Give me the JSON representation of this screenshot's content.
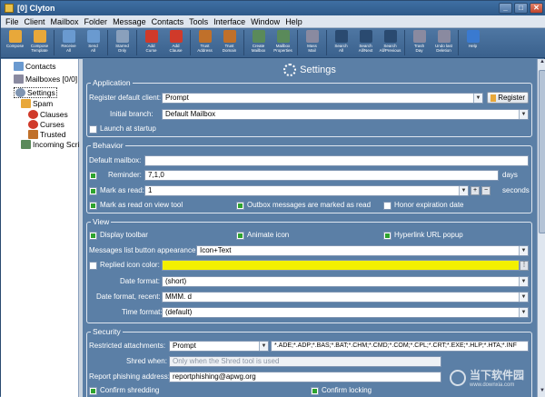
{
  "window": {
    "title": "[0] Clyton"
  },
  "menu": [
    "File",
    "Client",
    "Mailbox",
    "Folder",
    "Message",
    "Contacts",
    "Tools",
    "Interface",
    "Window",
    "Help"
  ],
  "toolbar": [
    {
      "label": "Compose",
      "icon": "compose-icon",
      "color": "#e8a83a"
    },
    {
      "label": "Compose\nTemplate",
      "icon": "template-icon",
      "color": "#e8a83a"
    },
    {
      "label": "Receive\nAll",
      "icon": "receive-icon",
      "color": "#6a9ad0"
    },
    {
      "label": "Send\nAll",
      "icon": "send-icon",
      "color": "#6a9ad0"
    },
    {
      "label": "Starred\nOnly",
      "icon": "star-icon",
      "color": "#8aa0bc"
    },
    {
      "label": "Add\nCurse",
      "icon": "curse-icon",
      "color": "#d03a2a"
    },
    {
      "label": "Add\nClause",
      "icon": "clause-icon",
      "color": "#d03a2a"
    },
    {
      "label": "Trust\nAddress",
      "icon": "trust-address-icon",
      "color": "#c0702a"
    },
    {
      "label": "Trust\nDomain",
      "icon": "trust-domain-icon",
      "color": "#c0702a"
    },
    {
      "label": "Create\nMailbox",
      "icon": "create-mailbox-icon",
      "color": "#5a8a5a"
    },
    {
      "label": "Mailbox\nProperties",
      "icon": "mailbox-properties-icon",
      "color": "#5a8a5a"
    },
    {
      "label": "Mass\nMail",
      "icon": "mass-mail-icon",
      "color": "#8a8aa0"
    },
    {
      "label": "Search\nAll",
      "icon": "search-all-icon",
      "color": "#2a4a70"
    },
    {
      "label": "Search\nAll/Next",
      "icon": "search-next-icon",
      "color": "#2a4a70"
    },
    {
      "label": "Search\nAll/Previous",
      "icon": "search-previous-icon",
      "color": "#2a4a70"
    },
    {
      "label": "Trash\nDay",
      "icon": "trash-icon",
      "color": "#8a8aa0"
    },
    {
      "label": "Undo last\nDeletion",
      "icon": "undo-icon",
      "color": "#8a8aa0"
    },
    {
      "label": "Help",
      "icon": "help-icon",
      "color": "#3a7ad0"
    }
  ],
  "tree": {
    "contacts": "Contacts",
    "mailboxes": "Mailboxes [0/0]",
    "settings": "Settings",
    "spam": "Spam",
    "clauses": "Clauses",
    "curses": "Curses",
    "trusted": "Trusted",
    "incoming": "Incoming Scripts"
  },
  "page": {
    "title": "Settings"
  },
  "application": {
    "legend": "Application",
    "register_label": "Register default client:",
    "register_value": "Prompt",
    "register_button": "Register",
    "branch_label": "Initial branch:",
    "branch_value": "Default Mailbox",
    "launch_label": "Launch at startup"
  },
  "behavior": {
    "legend": "Behavior",
    "default_mailbox_label": "Default mailbox:",
    "default_mailbox_value": "",
    "reminder_label": "Reminder:",
    "reminder_value": "7,1,0",
    "reminder_unit": "days",
    "mark_read_label": "Mark as read:",
    "mark_read_value": "1",
    "mark_read_unit": "seconds",
    "mark_view_label": "Mark as read on view tool",
    "outbox_label": "Outbox messages are marked as read",
    "honor_label": "Honor expiration date"
  },
  "view": {
    "legend": "View",
    "display_toolbar": "Display toolbar",
    "animate_icon": "Animate icon",
    "hyperlink_popup": "Hyperlink URL popup",
    "list_button_label": "Messages list button appearance:",
    "list_button_value": "Icon+Text",
    "replied_color_label": "Replied icon color:",
    "replied_color": "#f3f000",
    "date_format_label": "Date format:",
    "date_format_value": "(short)",
    "date_recent_label": "Date format, recent:",
    "date_recent_value": "MMM. d",
    "time_format_label": "Time format:",
    "time_format_value": "(default)"
  },
  "security": {
    "legend": "Security",
    "restricted_label": "Restricted attachments:",
    "restricted_value": "Prompt",
    "restricted_ext": "*.ADE;*.ADP;*.BAS;*.BAT;*.CHM;*.CMD;*.COM;*.CPL;*.CRT;*.EXE;*.HLP;*.HTA;*.INF",
    "shred_label": "Shred when:",
    "shred_placeholder": "Only when the Shred tool is used",
    "phishing_label": "Report phishing address:",
    "phishing_value": "reportphishing@apwg.org",
    "confirm_shredding": "Confirm shredding",
    "confirm_locking": "Confirm locking"
  },
  "watermark": {
    "text": "当下软件园",
    "sub": "www.downxia.com"
  }
}
